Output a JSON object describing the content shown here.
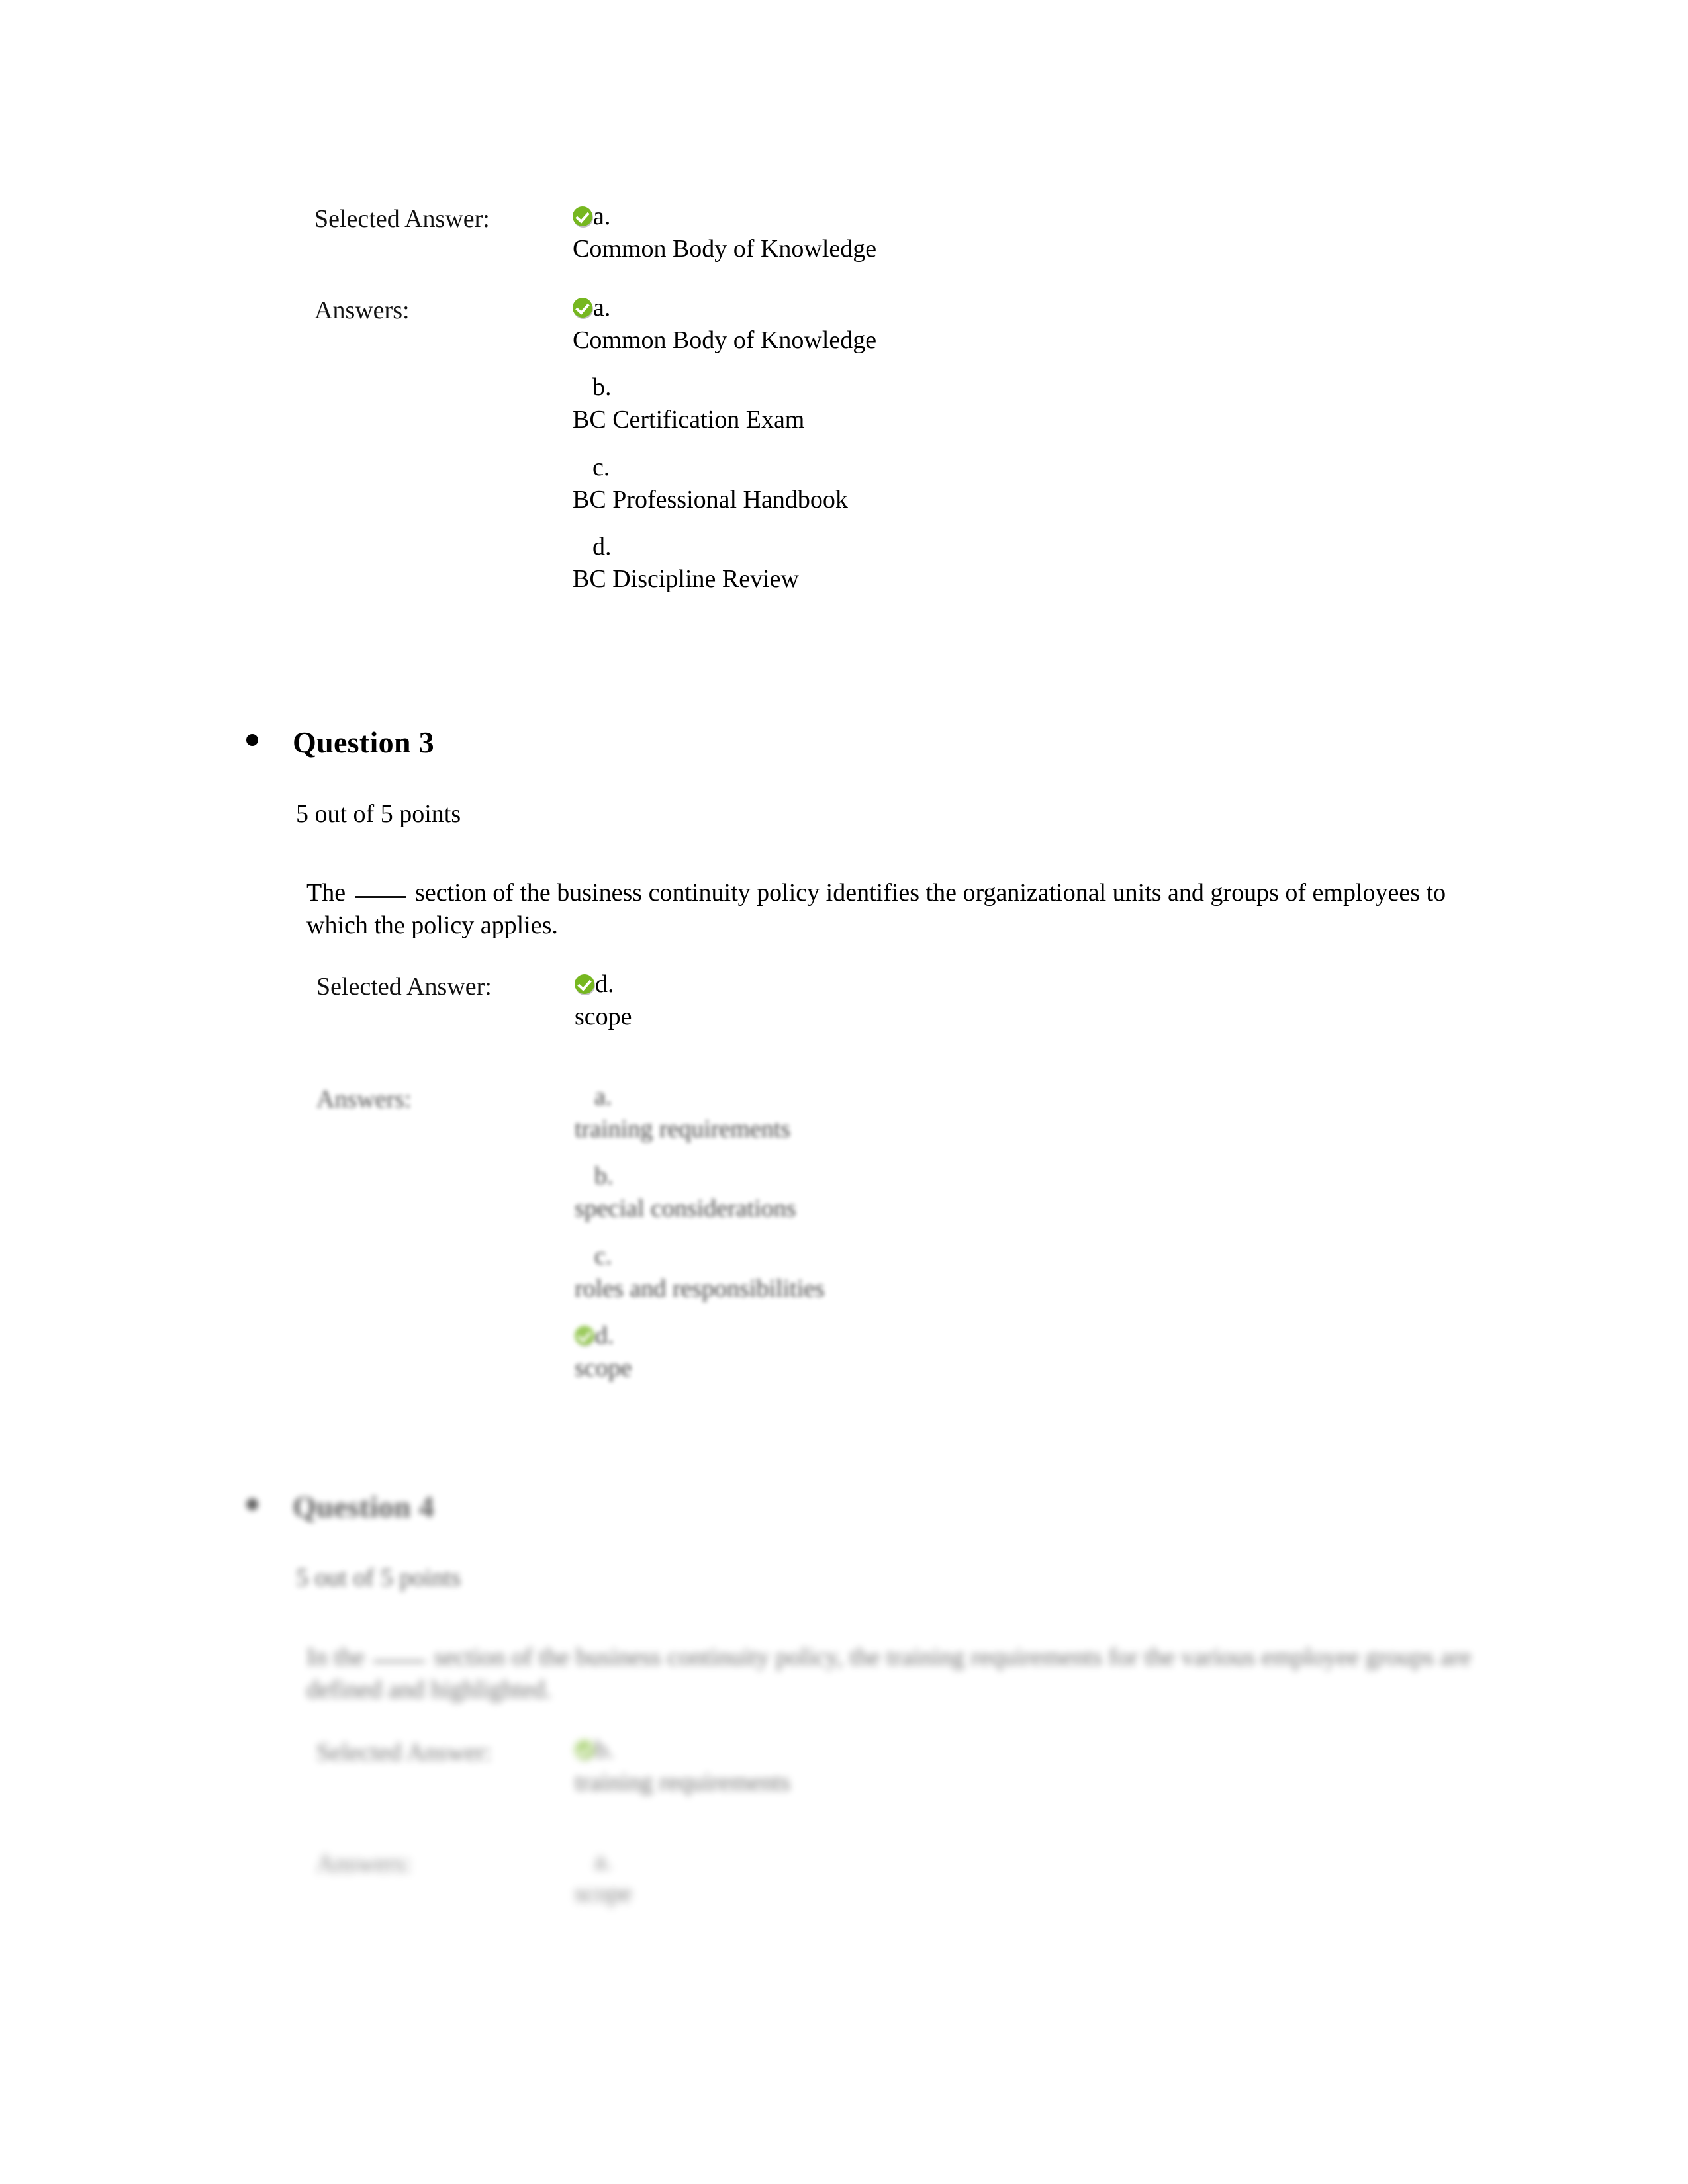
{
  "document": {
    "type": "quiz-review",
    "page_background": "#ffffff",
    "correct_marker_color": "#76b720",
    "text_color": "#111111"
  },
  "labels": {
    "selected_answer": "Selected Answer:",
    "answers": "Answers:",
    "correct_icon": "green-check-icon"
  },
  "question2_tail": {
    "selected_answer": {
      "letter": "a.",
      "text": "Common Body of Knowledge",
      "correct": true
    },
    "answers": [
      {
        "letter": "a.",
        "text": "Common Body of Knowledge",
        "correct": true
      },
      {
        "letter": "b.",
        "text": "BC Certification Exam",
        "correct": false
      },
      {
        "letter": "c.",
        "text": "BC Professional Handbook",
        "correct": false
      },
      {
        "letter": "d.",
        "text": "BC Discipline Review",
        "correct": false
      }
    ]
  },
  "question3": {
    "title": "Question 3",
    "points": "5 out of 5 points",
    "text_before_blank": "The ",
    "text_after_blank": " section of the business continuity policy identifies the organizational units and groups of employees to which the policy applies.",
    "selected_answer": {
      "letter": "d.",
      "text": "scope",
      "correct": true
    },
    "answers": [
      {
        "letter": "a.",
        "text": "training requirements",
        "correct": false
      },
      {
        "letter": "b.",
        "text": "special considerations",
        "correct": false
      },
      {
        "letter": "c.",
        "text": "roles and responsibilities",
        "correct": false
      },
      {
        "letter": "d.",
        "text": "scope",
        "correct": true
      }
    ]
  },
  "question4": {
    "title": "Question 4",
    "points": "5 out of 5 points",
    "text_before_blank": "In the ",
    "text_after_blank": " section of the business continuity policy, the training requirements for the various employee groups are defined and highlighted.",
    "selected_answer": {
      "letter": "b.",
      "text": "training requirements",
      "correct": true
    },
    "answers": [
      {
        "letter": "a.",
        "text": "scope",
        "correct": false
      }
    ]
  }
}
